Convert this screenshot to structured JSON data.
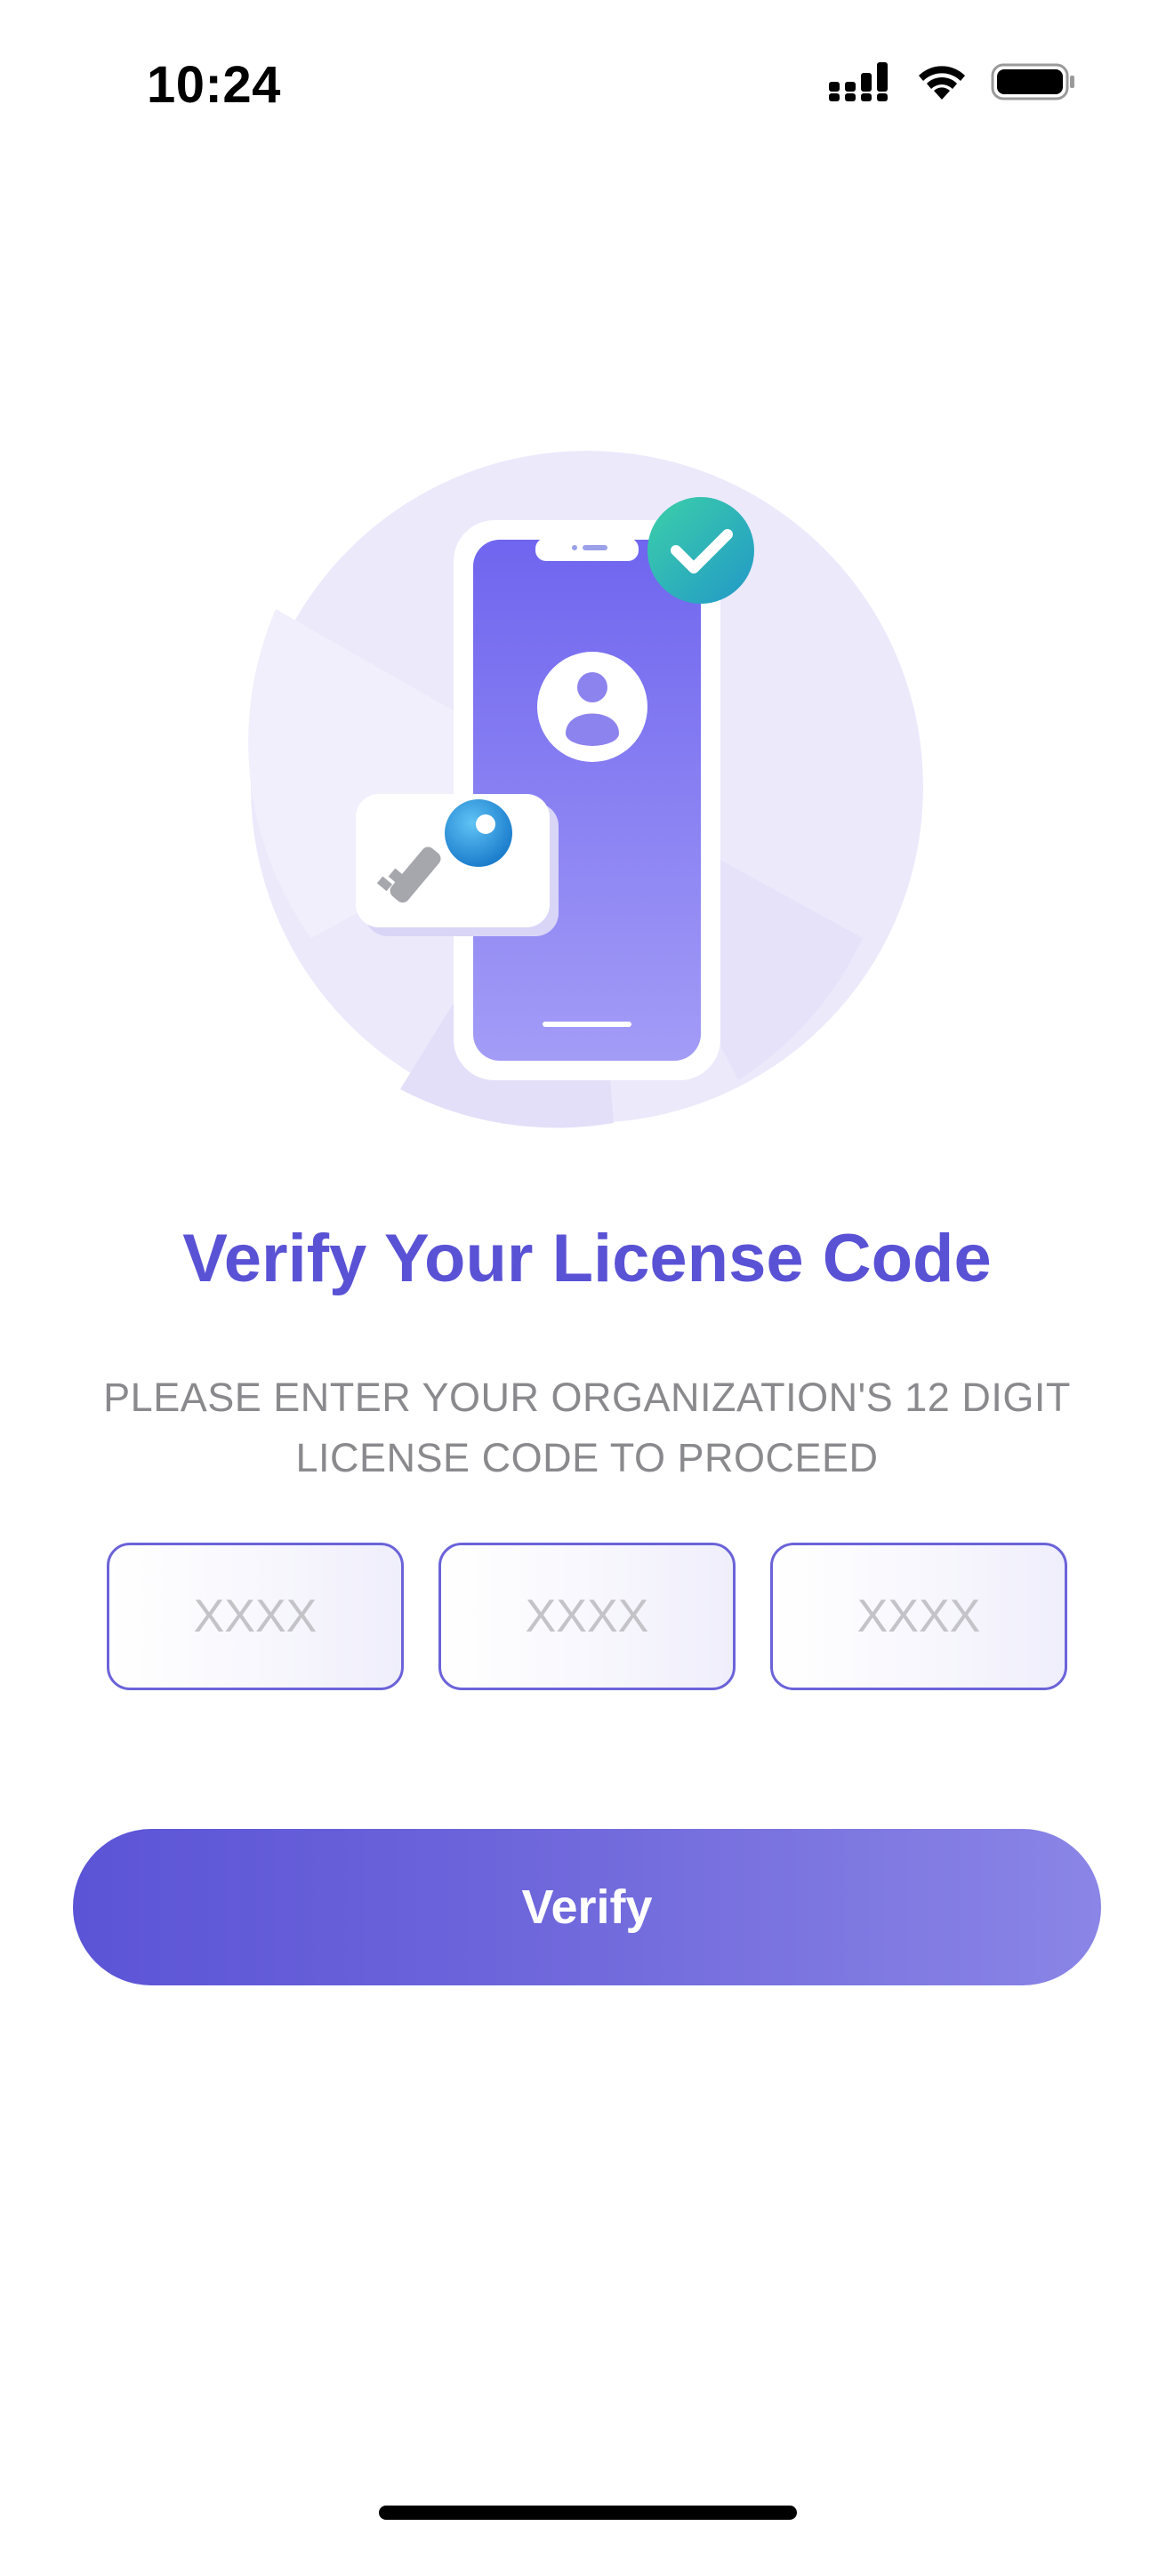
{
  "status_bar": {
    "time": "10:24",
    "icons": [
      "cellular-signal-icon",
      "wifi-icon",
      "battery-icon"
    ]
  },
  "illustration": {
    "icons": [
      "phone-icon",
      "user-avatar-icon",
      "key-icon",
      "checkmark-icon"
    ]
  },
  "main": {
    "title": "Verify Your License Code",
    "subtitle_line1": "PLEASE ENTER YOUR ORGANIZATION'S 12 DIGIT",
    "subtitle_line2": "LICENSE CODE TO PROCEED",
    "code_inputs": [
      {
        "placeholder": "XXXX",
        "value": ""
      },
      {
        "placeholder": "XXXX",
        "value": ""
      },
      {
        "placeholder": "XXXX",
        "value": ""
      }
    ],
    "verify_label": "Verify"
  },
  "colors": {
    "accent": "#5a52d5",
    "input_border": "#6b63d9",
    "subtitle": "#8a8a8e",
    "check_badge": "#2bbfa4",
    "key": "#2a9ee0"
  }
}
